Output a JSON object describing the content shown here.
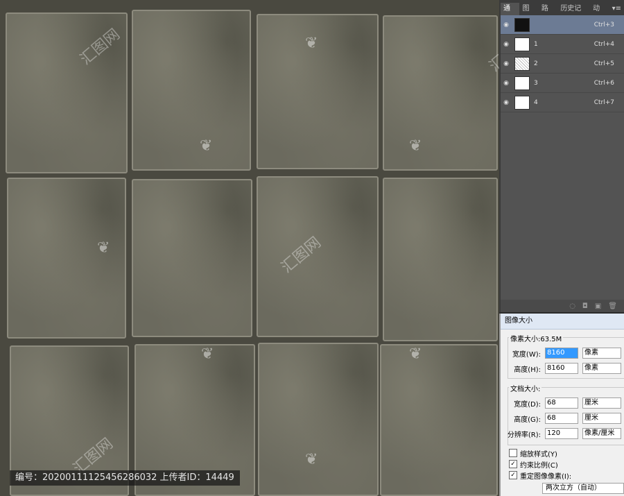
{
  "canvas": {
    "watermark_text": "汇图网",
    "caption": "编号：20200111125456286032 上传者ID：14449"
  },
  "channels_panel": {
    "tabs": [
      "通道",
      "图层",
      "路径",
      "历史记录",
      "动作"
    ],
    "active_tab": "通道",
    "rows": [
      {
        "name": "",
        "shortcut": "Ctrl+3"
      },
      {
        "name": "1",
        "shortcut": "Ctrl+4"
      },
      {
        "name": "2",
        "shortcut": "Ctrl+5"
      },
      {
        "name": "3",
        "shortcut": "Ctrl+6"
      },
      {
        "name": "4",
        "shortcut": "Ctrl+7"
      }
    ]
  },
  "image_size_dialog": {
    "title": "图像大小",
    "pixel_dimensions": "像素大小:63.5M",
    "width_label": "宽度(W):",
    "width_value": "8160",
    "width_unit": "像素",
    "height_label": "高度(H):",
    "height_value": "8160",
    "height_unit": "像素",
    "document_size": "文档大小:",
    "doc_width_label": "宽度(D):",
    "doc_width_value": "68",
    "doc_width_unit": "厘米",
    "doc_height_label": "高度(G):",
    "doc_height_value": "68",
    "doc_height_unit": "厘米",
    "resolution_label": "分辨率(R):",
    "resolution_value": "120",
    "resolution_unit": "像素/厘米",
    "scale_styles": "缩放样式(Y)",
    "constrain": "约束比例(C)",
    "resample": "重定图像像素(I):",
    "resample_method": "两次立方（自动）"
  }
}
